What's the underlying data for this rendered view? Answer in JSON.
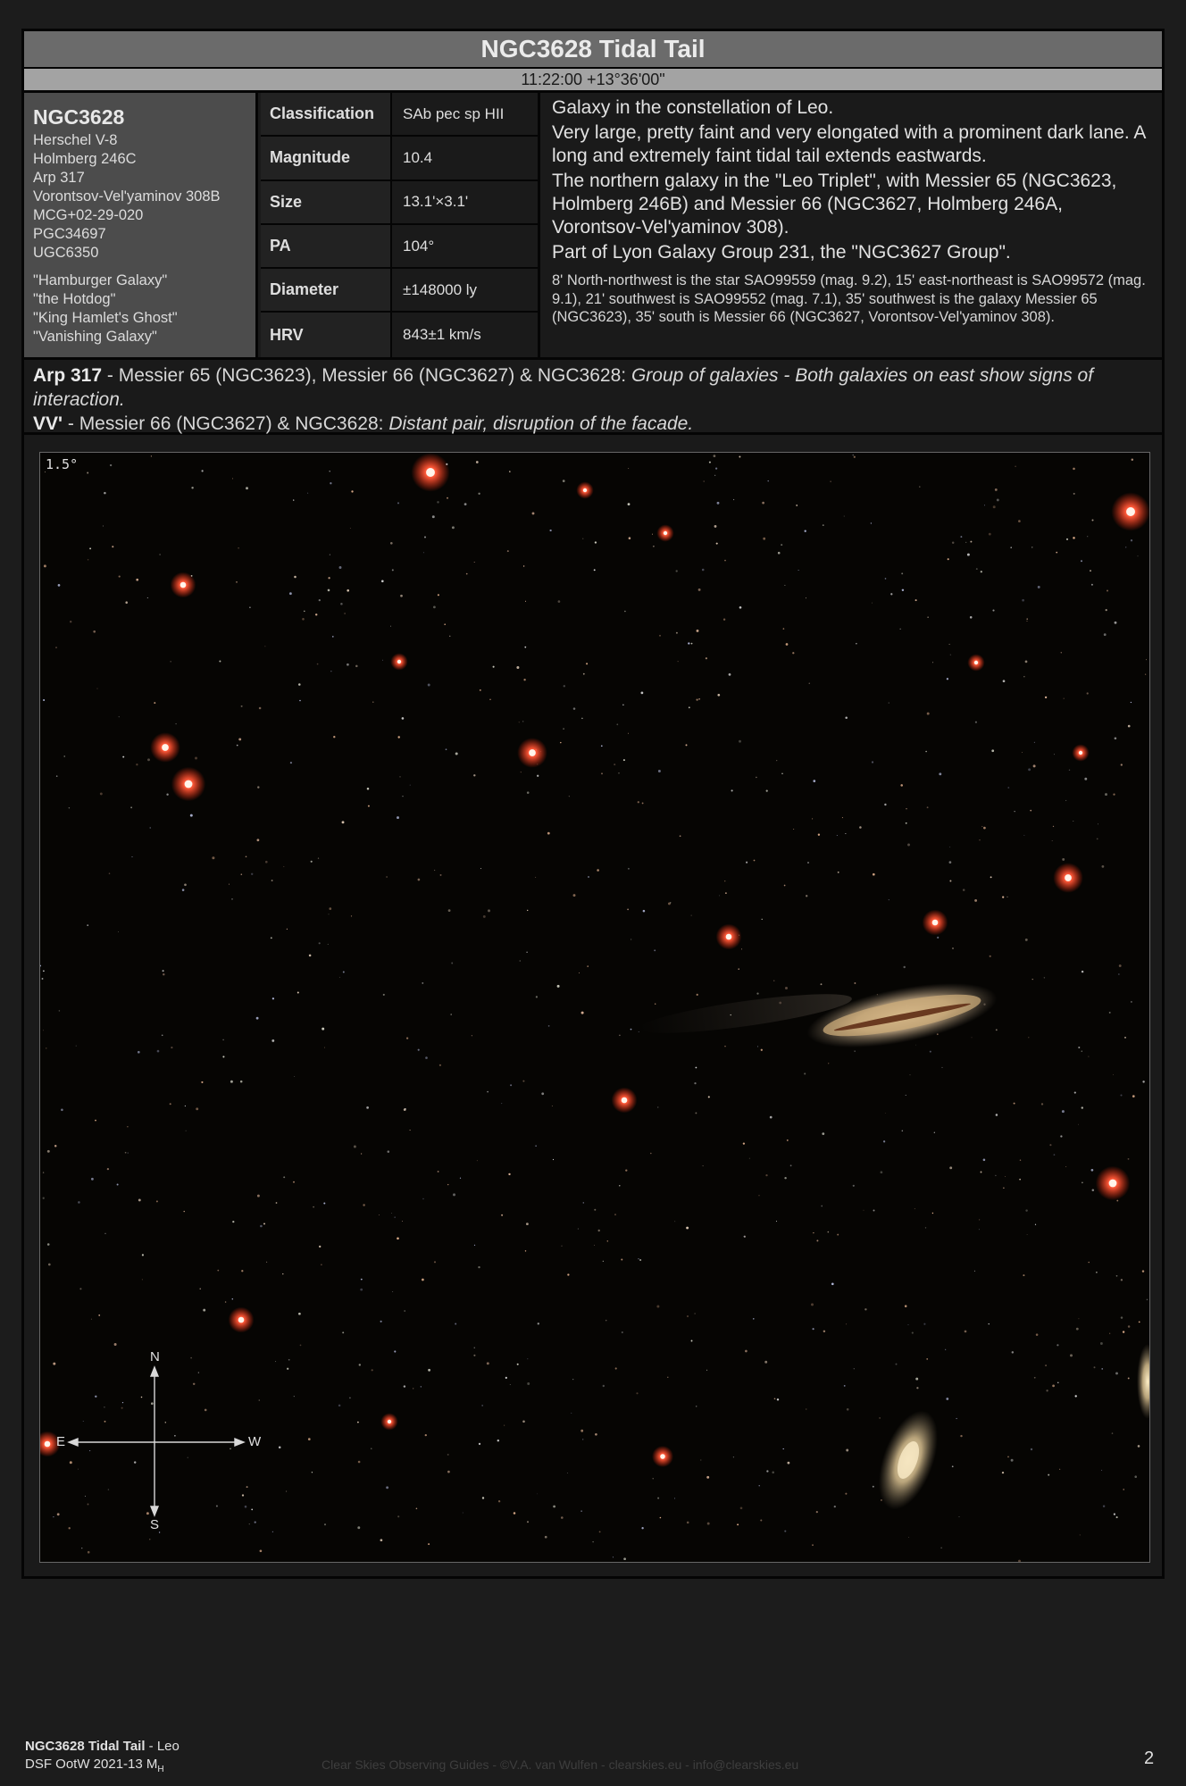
{
  "header": {
    "title": "NGC3628 Tidal Tail",
    "coordinates": "11:22:00 +13°36'00\""
  },
  "names": {
    "object": "NGC3628",
    "designations": [
      "Herschel V-8",
      "Holmberg 246C",
      "Arp 317",
      "Vorontsov-Vel'yaminov 308B",
      "MCG+02-29-020",
      "PGC34697",
      "UGC6350"
    ],
    "nicknames": [
      "\"Hamburger Galaxy\"",
      "\"the Hotdog\"",
      "\"King Hamlet's Ghost\"",
      "\"Vanishing Galaxy\""
    ]
  },
  "properties": [
    {
      "key": "Classification",
      "value": "SAb pec sp HII"
    },
    {
      "key": "Magnitude",
      "value": "10.4"
    },
    {
      "key": "Size",
      "value": "13.1'×3.1'"
    },
    {
      "key": "PA",
      "value": "104°"
    },
    {
      "key": "Diameter",
      "value": "±148000 ly"
    },
    {
      "key": "HRV",
      "value": "843±1 km/s"
    }
  ],
  "description": {
    "lines": [
      "Galaxy in the constellation of Leo.",
      "Very large, pretty faint and very elongated with a prominent dark lane. A long and extremely faint tidal tail extends eastwards.",
      "The northern galaxy in the \"Leo Triplet\", with Messier 65 (NGC3623, Holmberg 246B) and Messier 66 (NGC3627, Holmberg 246A, Vorontsov-Vel'yaminov 308).",
      "Part of Lyon Galaxy Group 231, the \"NGC3627 Group\"."
    ],
    "neighbors": "8' North-northwest is the star SAO99559 (mag. 9.2), 15' east-northeast is SAO99572 (mag. 9.1), 21' southwest is SAO99552 (mag. 7.1), 35' southwest is the galaxy Messier 65 (NGC3623), 35' south is Messier 66 (NGC3627, Vorontsov-Vel'yaminov 308)."
  },
  "groups": [
    {
      "catalog": "Arp 317",
      "sep": " - ",
      "members": "Messier 65 (NGC3623), Messier 66 (NGC3627) & NGC3628: ",
      "note": "Group of galaxies - Both galaxies on east show signs of interaction."
    },
    {
      "catalog": "VV'",
      "sep": " - ",
      "members": "Messier 66 (NGC3627) & NGC3628: ",
      "note": "Distant pair, disruption of the facade."
    }
  ],
  "image": {
    "field_of_view": "1.5°",
    "compass": {
      "n": "N",
      "s": "S",
      "e": "E",
      "w": "W"
    }
  },
  "footer": {
    "title": "NGC3628 Tidal Tail",
    "constellation": " - Leo",
    "guide": "DSF OotW 2021-13 M",
    "guide_sub": "H",
    "credit": "Clear Skies Observing Guides - ©V.A. van Wulfen - clearskies.eu - info@clearskies.eu",
    "page": "2"
  }
}
